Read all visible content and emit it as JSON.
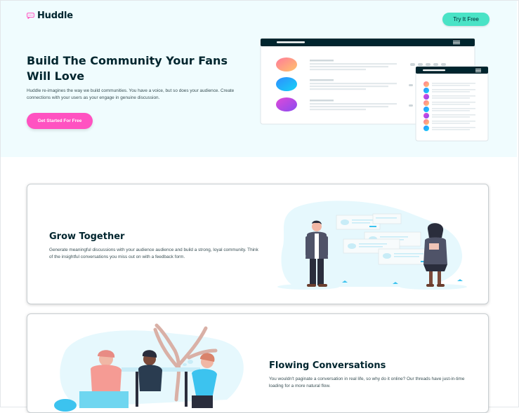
{
  "header": {
    "logo_text": "Huddle",
    "logo_icon": "chat-bubble-icon",
    "cta_label": "Try It Free"
  },
  "hero": {
    "title": "Build The Community Your Fans Will Love",
    "description": "Huddle re-imagines the way we build communities. You have a voice, but so does your audience. Create connections with your users as your engage in genuine discussion.",
    "cta_label": "Get Started For Free"
  },
  "features": [
    {
      "title": "Grow Together",
      "description": "Generate meaningful discussions with your audience audience and build a strong, loyal community. Think of the insightful conversations you miss out on with a feedback form."
    },
    {
      "title": "Flowing Conversations",
      "description": "You wouldn't paginate a conversation in real life, so why do it online? Our threads have just-in-time loading for a more natural flow."
    }
  ],
  "colors": {
    "brand_pink": "#ff52c1",
    "brand_cyan": "#4ae3c6",
    "dark_navy": "#00252e",
    "hero_bg": "#f0fcfe"
  }
}
